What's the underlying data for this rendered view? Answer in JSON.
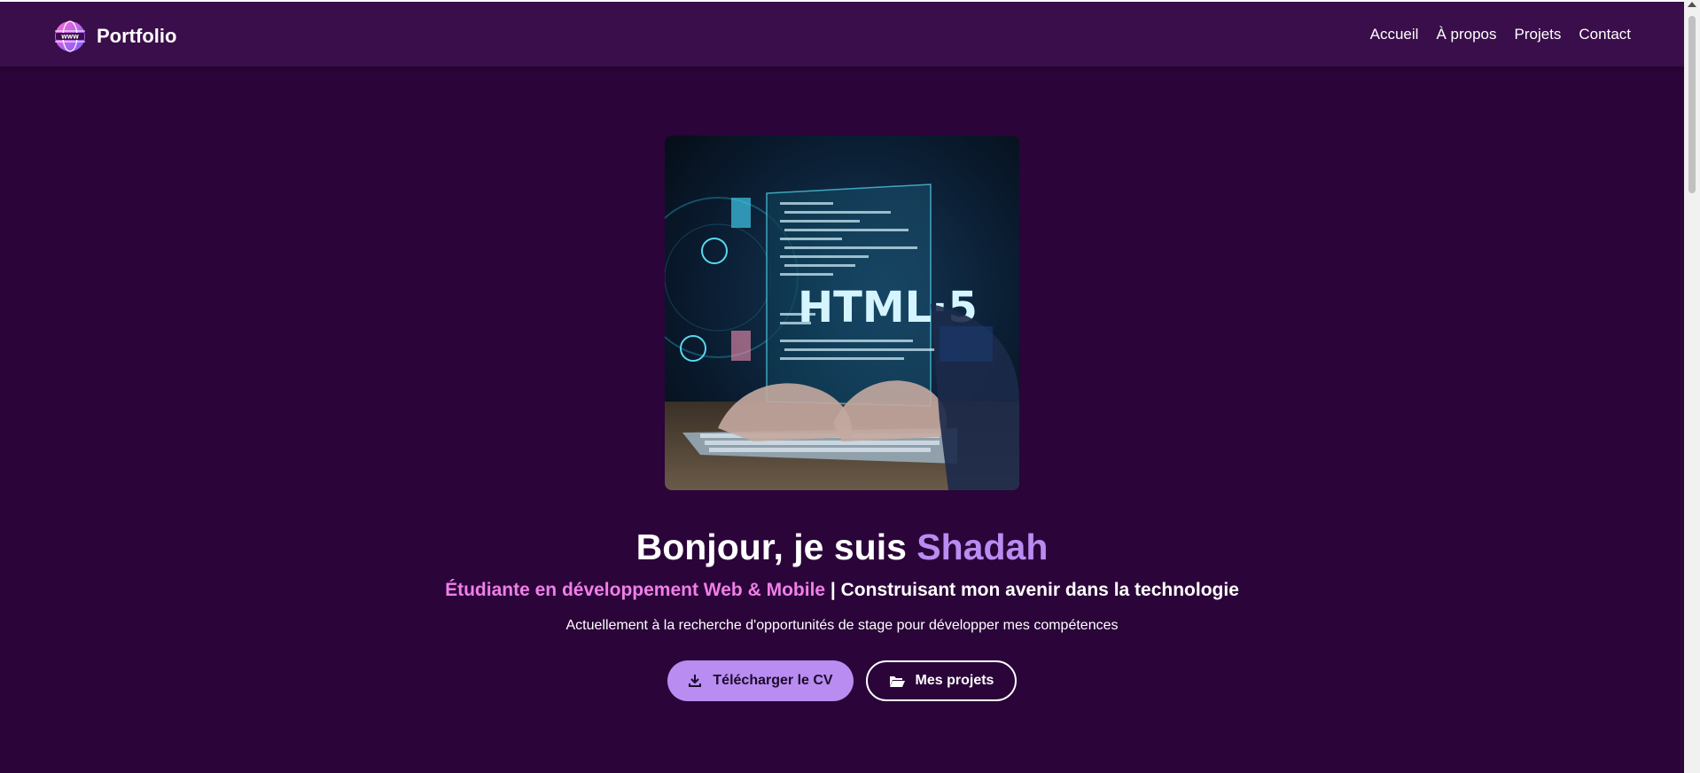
{
  "header": {
    "brand": "Portfolio",
    "logo_icon": "globe-www-icon",
    "nav": [
      "Accueil",
      "À propos",
      "Projets",
      "Contact"
    ]
  },
  "hero": {
    "image_caption": "HTML·5",
    "title_prefix": "Bonjour, je suis ",
    "title_name": "Shadah",
    "subtitle_role": "Étudiante en développement Web & Mobile",
    "subtitle_separator": " | ",
    "subtitle_tagline": "Construisant mon avenir dans la technologie",
    "description": "Actuellement à la recherche d'opportunités de stage pour développer mes compétences",
    "buttons": {
      "cv": "Télécharger le CV",
      "projects": "Mes projets"
    }
  },
  "colors": {
    "background": "#2b0439",
    "navbar": "#3a0e4a",
    "accent_purple": "#b98cf2",
    "accent_pink": "#f07fe8"
  }
}
